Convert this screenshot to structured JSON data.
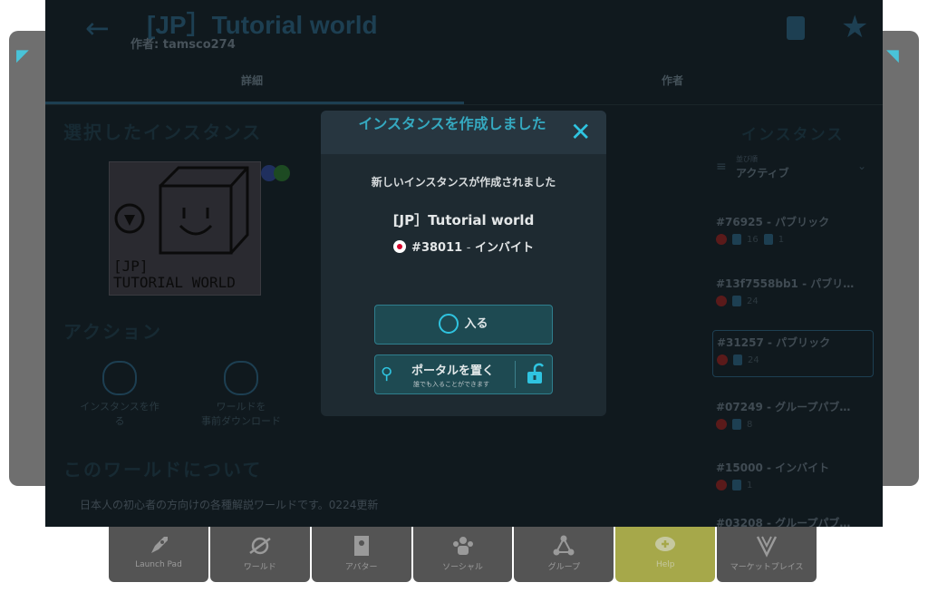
{
  "main": {
    "world_title": "[JP］Tutorial world",
    "author_line": "作者: tamsco274",
    "tabs": {
      "details": "詳細",
      "author": "作者"
    },
    "selected_instance_heading": "選択したインスタンス",
    "thumbnail_text_line1": "[JP]",
    "thumbnail_text_line2": "TUTORIAL WORLD",
    "actions_heading": "アクション",
    "actions": [
      {
        "label_line1": "インスタンスを作",
        "label_line2": "る"
      },
      {
        "label_line1": "ワールドを",
        "label_line2": "事前ダウンロード"
      }
    ],
    "about_heading": "このワールドについて",
    "about_text": "日本人の初心者の方向けの各種解説ワールドです。0224更新"
  },
  "instances": {
    "heading": "インスタンス",
    "sort_label": "並び順",
    "sort_value": "アクティブ",
    "items": [
      {
        "name": "#76925 - パブリック",
        "count": "16",
        "friends": "1"
      },
      {
        "name": "#13f7558bb1 - パブリ…",
        "count": "24"
      },
      {
        "name": "#31257 - パブリック",
        "count": "24"
      },
      {
        "name": "#07249 - グループパブ…",
        "count": "8"
      },
      {
        "name": "#15000 - インバイト",
        "count": "1"
      },
      {
        "name": "#03208 - グループパブ…"
      }
    ]
  },
  "modal": {
    "title": "インスタンスを作成しました",
    "description": "新しいインスタンスが作成されました",
    "world_name": "[JP］Tutorial world",
    "instance_id": "#38011",
    "instance_separator": "-",
    "instance_type": "インバイト",
    "enter_label": "入る",
    "portal_label": "ポータルを置く",
    "portal_sub": "誰でも入ることができます"
  },
  "dock": [
    {
      "label": "Launch Pad",
      "icon": "rocket-icon"
    },
    {
      "label": "ワールド",
      "icon": "planet-icon"
    },
    {
      "label": "アバター",
      "icon": "avatar-icon"
    },
    {
      "label": "ソーシャル",
      "icon": "social-icon"
    },
    {
      "label": "グループ",
      "icon": "group-icon"
    },
    {
      "label": "Help",
      "icon": "help-chat-icon",
      "active": true
    },
    {
      "label": "マーケットプレイス",
      "icon": "marketplace-icon"
    }
  ],
  "colors": {
    "accent": "#2fc4e0",
    "modal_bg": "#1e2a31",
    "dim_bg": "#10191e",
    "help_tab": "#a6a84a"
  }
}
